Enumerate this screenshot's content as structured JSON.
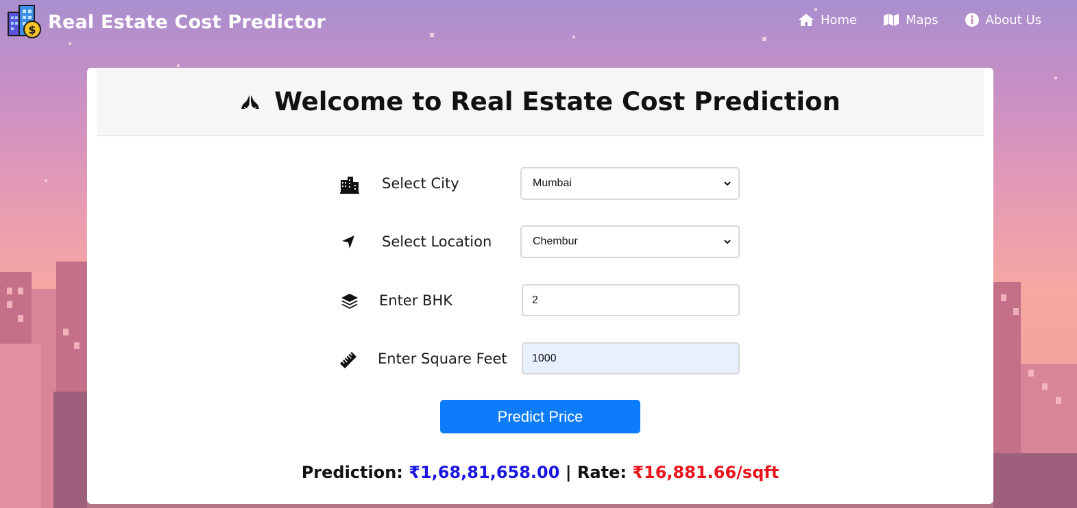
{
  "app": {
    "title": "Real Estate Cost Predictor"
  },
  "nav": {
    "items": [
      {
        "label": "Home",
        "icon": "home-icon"
      },
      {
        "label": "Maps",
        "icon": "map-icon"
      },
      {
        "label": "About Us",
        "icon": "info-icon"
      }
    ]
  },
  "card": {
    "heading": "Welcome to Real Estate Cost Prediction",
    "heading_icon": "praying-hands-icon"
  },
  "form": {
    "city": {
      "label": "Select City",
      "icon": "city-icon",
      "value": "Mumbai"
    },
    "location": {
      "label": "Select Location",
      "icon": "location-arrow-icon",
      "value": "Chembur"
    },
    "bhk": {
      "label": "Enter BHK",
      "icon": "layers-icon",
      "value": "2"
    },
    "sqft": {
      "label": "Enter Square Feet",
      "icon": "ruler-icon",
      "value": "1000"
    },
    "submit_label": "Predict Price"
  },
  "result": {
    "prediction_label": "Prediction:",
    "prediction_value": "₹1,68,81,658.00",
    "separator": "|",
    "rate_label": "Rate:",
    "rate_value": "₹16,881.66/sqft"
  },
  "colors": {
    "accent": "#0d7cfa",
    "prediction": "#1a16e0",
    "rate": "#e8131c"
  }
}
